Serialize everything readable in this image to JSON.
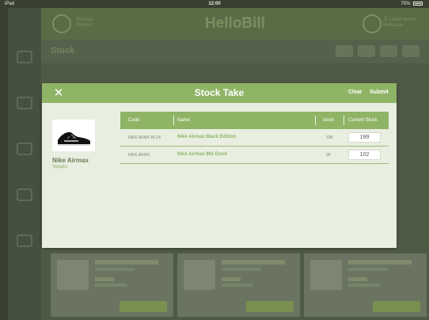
{
  "status_bar": {
    "device": "iPad",
    "time": "12:00",
    "battery": "75%"
  },
  "background_app": {
    "title": "HelloBill",
    "brand_line1": "Ekaraya",
    "brand_line2": "Kitchen",
    "store_line1": "Jl. Lorem Ipsum",
    "store_line2": "Makassar",
    "page_title": "Stock"
  },
  "modal": {
    "title": "Stock Take",
    "clear_label": "Clear",
    "submit_label": "Submit",
    "close_icon": "close-icon",
    "product": {
      "name": "Nike Airmax",
      "category": "Sepatu"
    },
    "table": {
      "headers": {
        "code": "Code",
        "name": "Name",
        "stock": "stock",
        "current_stock": "Current Stock"
      },
      "rows": [
        {
          "code": "NIKE ARMX BLCK",
          "name": "Nike Airmax Black Edition",
          "stock": "198",
          "current_stock": "199"
        },
        {
          "code": "NIKE ARMX",
          "name": "Nike Airmax 90s Dunk",
          "stock": "99",
          "current_stock": "102"
        }
      ]
    }
  },
  "colors": {
    "accent": "#8fb466",
    "modal_bg": "#e8eee0",
    "overlay_bg": "#4f5a45"
  }
}
